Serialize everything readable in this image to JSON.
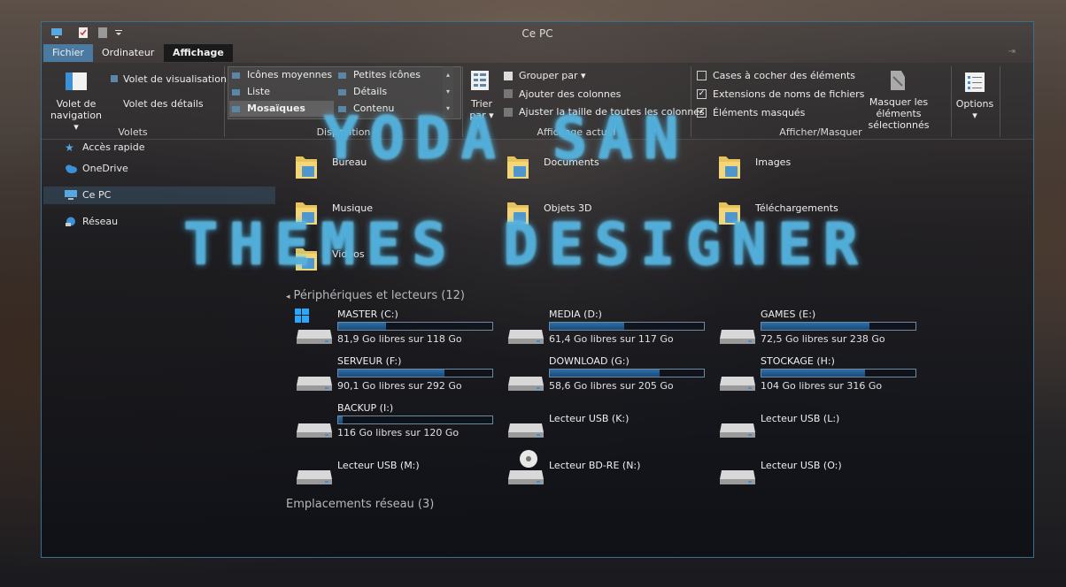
{
  "window": {
    "title": "Ce PC"
  },
  "tabs": [
    {
      "label": "Fichier"
    },
    {
      "label": "Ordinateur"
    },
    {
      "label": "Affichage"
    }
  ],
  "ribbon": {
    "volets": {
      "nav_label": "Volet de navigation ▾",
      "preview": "Volet de visualisation",
      "details": "Volet des détails",
      "group": "Volets"
    },
    "disposition": {
      "items": [
        "Icônes moyennes",
        "Petites icônes",
        "Liste",
        "Détails",
        "Mosaïques",
        "Contenu"
      ],
      "group": "Disposition"
    },
    "affichage_actuel": {
      "sort": "Trier par ▾",
      "group_by": "Grouper par ▾",
      "add_columns": "Ajouter des colonnes",
      "fit_columns": "Ajuster la taille de toutes les colonnes",
      "group": "Affichage actuel"
    },
    "afficher_masquer": {
      "checkbox_items": "Cases à cocher des éléments",
      "extensions": "Extensions de noms de fichiers",
      "hidden": "Éléments masqués",
      "hide_selected": "Masquer les éléments sélectionnés",
      "group": "Afficher/Masquer"
    },
    "options": {
      "label": "Options ▾"
    }
  },
  "nav": {
    "items": [
      {
        "label": "Accès rapide"
      },
      {
        "label": "OneDrive"
      },
      {
        "label": "Ce PC"
      },
      {
        "label": "Réseau"
      }
    ]
  },
  "folders": [
    {
      "name": "Bureau",
      "icon": "desktop-folder-icon"
    },
    {
      "name": "Documents",
      "icon": "documents-folder-icon"
    },
    {
      "name": "Images",
      "icon": "pictures-folder-icon"
    },
    {
      "name": "Musique",
      "icon": "music-folder-icon"
    },
    {
      "name": "Objets 3D",
      "icon": "3d-objects-folder-icon"
    },
    {
      "name": "Téléchargements",
      "icon": "downloads-folder-icon"
    },
    {
      "name": "Vidéos",
      "icon": "videos-folder-icon"
    }
  ],
  "devices_section": "Périphériques et lecteurs (12)",
  "drives": [
    {
      "name": "MASTER (C:)",
      "free": "81,9 Go libres sur 118 Go",
      "used": 0.31
    },
    {
      "name": "MEDIA (D:)",
      "free": "61,4 Go libres sur 117 Go",
      "used": 0.48
    },
    {
      "name": "GAMES (E:)",
      "free": "72,5 Go libres sur 238 Go",
      "used": 0.7
    },
    {
      "name": "SERVEUR (F:)",
      "free": "90,1 Go libres sur 292 Go",
      "used": 0.69
    },
    {
      "name": "DOWNLOAD (G:)",
      "free": "58,6 Go libres sur 205 Go",
      "used": 0.71
    },
    {
      "name": "STOCKAGE (H:)",
      "free": "104 Go libres sur 316 Go",
      "used": 0.67
    },
    {
      "name": "BACKUP (I:)",
      "free": "116 Go libres sur 120 Go",
      "used": 0.03
    },
    {
      "name": "Lecteur USB (K:)"
    },
    {
      "name": "Lecteur USB (L:)"
    },
    {
      "name": "Lecteur USB (M:)"
    },
    {
      "name": "Lecteur BD-RE (N:)"
    },
    {
      "name": "Lecteur USB (O:)"
    }
  ],
  "network_section": "Emplacements réseau (3)",
  "watermark": {
    "line1": "YODA SAN",
    "line2": "THEMES DESIGNER"
  },
  "colors": {
    "accent": "#4a7aa0",
    "bar_fill": "#2e6ea8"
  }
}
